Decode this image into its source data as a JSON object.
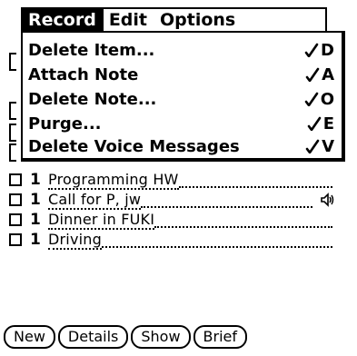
{
  "menubar": {
    "menus": [
      {
        "label": "Record",
        "active": true
      },
      {
        "label": "Edit",
        "active": false
      },
      {
        "label": "Options",
        "active": false
      }
    ]
  },
  "record_menu": {
    "items": [
      {
        "label": "Delete Item...",
        "shortcut": "D"
      },
      {
        "label": "Attach Note",
        "shortcut": "A"
      },
      {
        "label": "Delete Note...",
        "shortcut": "O"
      },
      {
        "label": "Purge...",
        "shortcut": "E"
      },
      {
        "label": "Delete Voice Messages",
        "shortcut": "V"
      }
    ]
  },
  "todo": {
    "items": [
      {
        "priority": "1",
        "description": "Programming HW",
        "checked": false,
        "has_voice": false
      },
      {
        "priority": "1",
        "description": "Call for P, jw",
        "checked": false,
        "has_voice": true
      },
      {
        "priority": "1",
        "description": "Dinner in FUKI",
        "checked": false,
        "has_voice": false
      },
      {
        "priority": "1",
        "description": "Driving",
        "checked": false,
        "has_voice": false
      }
    ]
  },
  "buttons": {
    "new": "New",
    "details": "Details",
    "show": "Show",
    "brief": "Brief"
  },
  "icons": {
    "shortcut_stroke": "command-stroke-icon",
    "voice_note": "speaker-icon"
  }
}
